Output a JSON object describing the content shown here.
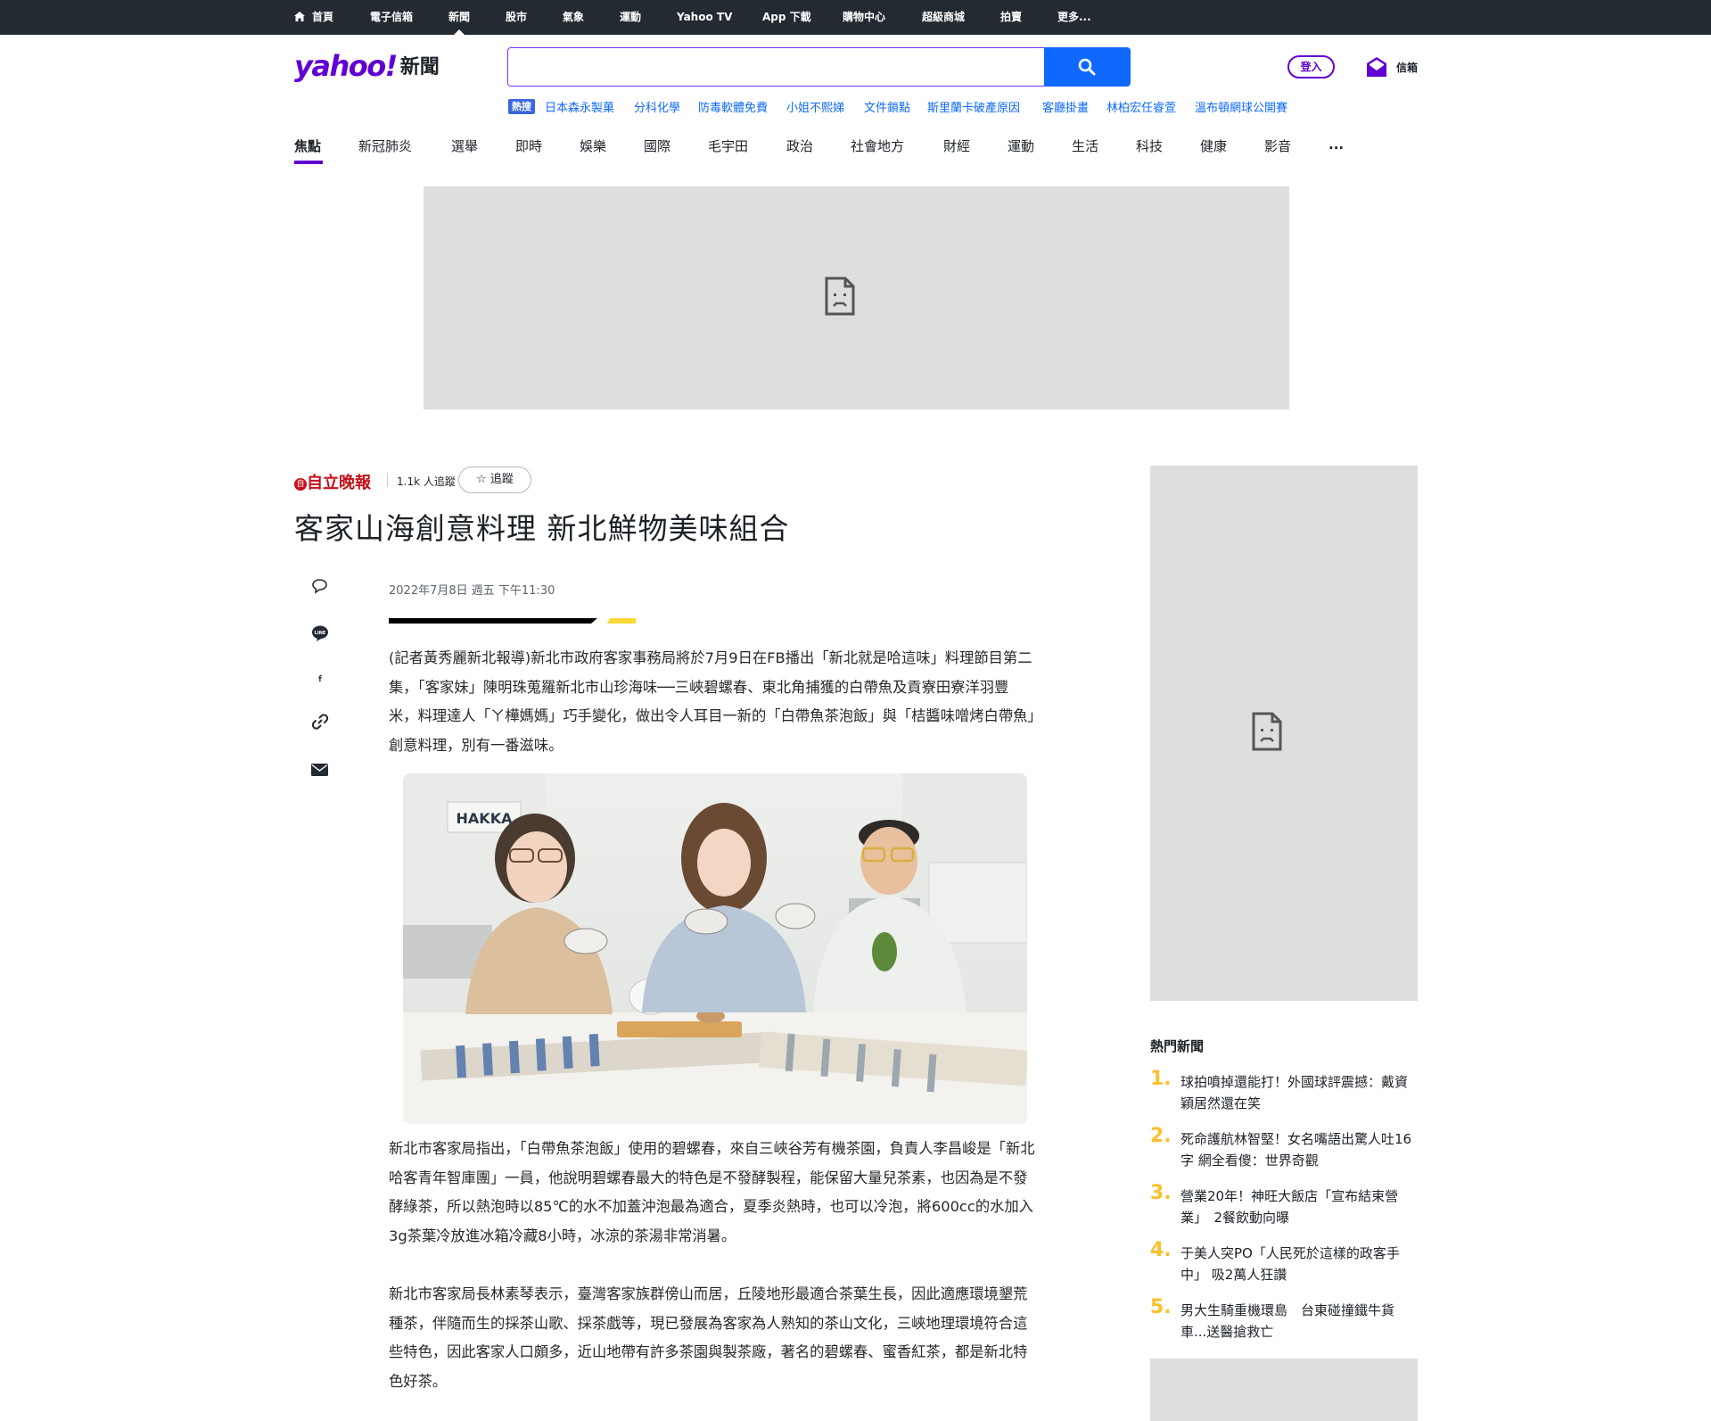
{
  "topnav": [
    {
      "label": "首頁",
      "icon": "home-icon"
    },
    {
      "label": "電子信箱"
    },
    {
      "label": "新聞",
      "active": true
    },
    {
      "label": "股市"
    },
    {
      "label": "氣象"
    },
    {
      "label": "運動"
    },
    {
      "label": "Yahoo TV"
    },
    {
      "label": "App 下載"
    },
    {
      "label": "購物中心"
    },
    {
      "label": "超級商城"
    },
    {
      "label": "拍賣"
    },
    {
      "label": "更多..."
    }
  ],
  "header": {
    "logo_text": "yahoo!",
    "logo_section": "新聞",
    "search_value": "",
    "login_label": "登入",
    "mail_label": "信箱"
  },
  "trending": {
    "tag": "熱搜",
    "items": [
      "日本森永製菓",
      "分科化學",
      "防毒軟體免費",
      "小姐不熙娣",
      "文件鎖點",
      "斯里蘭卡破產原因",
      "客廳掛畫",
      "林柏宏任睿萱",
      "溫布頓網球公開賽"
    ]
  },
  "categories": [
    "焦點",
    "新冠肺炎",
    "選舉",
    "即時",
    "娛樂",
    "國際",
    "毛宇田",
    "政治",
    "社會地方",
    "財經",
    "運動",
    "生活",
    "科技",
    "健康",
    "影音",
    "..."
  ],
  "article": {
    "publisher_mark": "自",
    "publisher": "自立晚報",
    "followers": "1.1k 人追蹤",
    "follow_label": "追蹤",
    "title": "客家山海創意料理 新北鮮物美味組合",
    "date": "2022年7月8日 週五 下午11:30",
    "paragraphs": [
      "(記者黃秀麗新北報導)新北市政府客家事務局將於7月9日在FB播出「新北就是哈這味」料理節目第二集，「客家妹」陳明珠蒐羅新北市山珍海味──三峽碧螺春、東北角捕獲的白帶魚及貢寮田寮洋羽豐米，料理達人「ㄚ樺媽媽」巧手變化，做出令人耳目一新的「白帶魚茶泡飯」與「桔醬味噌烤白帶魚」創意料理，別有一番滋味。",
      "新北市客家局指出，「白帶魚茶泡飯」使用的碧螺春，來自三峽谷芳有機茶園，負責人李昌峻是「新北哈客青年智庫團」一員，他說明碧螺春最大的特色是不發酵製程，能保留大量兒茶素，也因為是不發酵綠茶，所以熱泡時以85℃的水不加蓋沖泡最為適合，夏季炎熱時，也可以冷泡，將600cc的水加入3g茶葉冷放進冰箱冷藏8小時，冰涼的茶湯非常消暑。",
      "新北市客家局長林素琴表示，臺灣客家族群傍山而居，丘陵地形最適合茶葉生長，因此適應環境墾荒種茶，伴隨而生的採茶山歌、採茶戲等，現已發展為客家為人熟知的茶山文化，三峽地理環境符合這些特色，因此客家人口頗多，近山地帶有許多茶園與製茶廠，著名的碧螺春、蜜香紅茶，都是新北特色好茶。"
    ],
    "photo_sign": "HAKKA"
  },
  "sidebar": {
    "title": "熱門新聞",
    "items": [
      {
        "rank": "1.",
        "text": "球拍噴掉還能打！外國球評震撼：戴資穎居然還在笑"
      },
      {
        "rank": "2.",
        "text": "死命護航林智堅！女名嘴語出驚人吐16字 網全看傻：世界奇觀"
      },
      {
        "rank": "3.",
        "text": "營業20年！神旺大飯店「宣布結束營業」　2餐飲動向曝"
      },
      {
        "rank": "4.",
        "text": "于美人突PO「人民死於這樣的政客手中」 吸2萬人狂讚"
      },
      {
        "rank": "5.",
        "text": "男大生騎重機環島　台東碰撞鐵牛貨車...送醫搶救亡"
      }
    ]
  },
  "colors": {
    "brand": "#6001d2",
    "search": "#0f69ff",
    "rank": "#fbc02d",
    "topbar": "#232a31"
  }
}
